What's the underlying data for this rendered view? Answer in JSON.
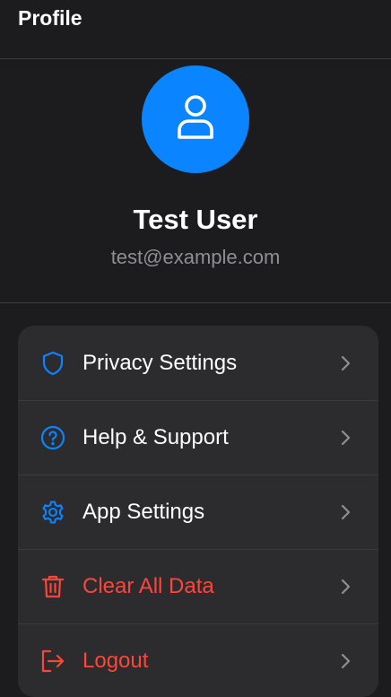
{
  "header": {
    "title": "Profile"
  },
  "profile": {
    "avatar_icon": "user-icon",
    "name": "Test User",
    "email": "test@example.com"
  },
  "menu": {
    "items": [
      {
        "label": "Privacy Settings",
        "icon": "shield-icon",
        "style": "default"
      },
      {
        "label": "Help & Support",
        "icon": "help-circle-icon",
        "style": "default"
      },
      {
        "label": "App Settings",
        "icon": "gear-icon",
        "style": "default"
      },
      {
        "label": "Clear All Data",
        "icon": "trash-icon",
        "style": "danger"
      },
      {
        "label": "Logout",
        "icon": "logout-icon",
        "style": "danger"
      }
    ]
  },
  "colors": {
    "background": "#1c1c1e",
    "card": "#2c2c2e",
    "accent": "#0a84ff",
    "danger": "#ff453a",
    "secondary_text": "#8e8e93"
  }
}
